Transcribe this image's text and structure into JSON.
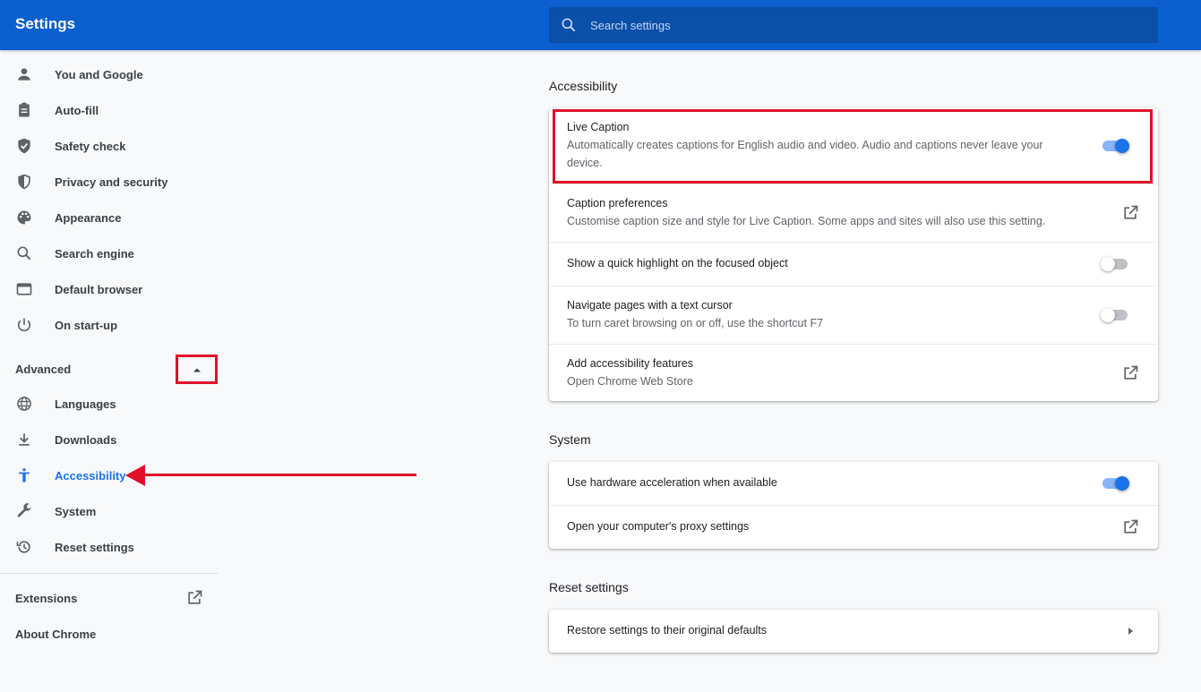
{
  "header": {
    "title": "Settings",
    "search_placeholder": "Search settings"
  },
  "sidebar": {
    "items": [
      {
        "label": "You and Google",
        "icon": "person-icon"
      },
      {
        "label": "Auto-fill",
        "icon": "clipboard-icon"
      },
      {
        "label": "Safety check",
        "icon": "shield-check-icon"
      },
      {
        "label": "Privacy and security",
        "icon": "shield-half-icon"
      },
      {
        "label": "Appearance",
        "icon": "palette-icon"
      },
      {
        "label": "Search engine",
        "icon": "search-icon"
      },
      {
        "label": "Default browser",
        "icon": "browser-window-icon"
      },
      {
        "label": "On start-up",
        "icon": "power-icon"
      }
    ],
    "advanced_label": "Advanced",
    "advanced_items": [
      {
        "label": "Languages",
        "icon": "globe-icon"
      },
      {
        "label": "Downloads",
        "icon": "download-icon"
      },
      {
        "label": "Accessibility",
        "icon": "accessibility-icon",
        "active": true
      },
      {
        "label": "System",
        "icon": "wrench-icon"
      },
      {
        "label": "Reset settings",
        "icon": "history-icon"
      }
    ],
    "extensions_label": "Extensions",
    "about_label": "About Chrome"
  },
  "accessibility": {
    "title": "Accessibility",
    "live_caption": {
      "title": "Live Caption",
      "desc_line1": "Automatically creates captions for English audio and video. Audio and captions never leave your",
      "desc_line2": "device.",
      "enabled": true
    },
    "caption_prefs": {
      "title": "Caption preferences",
      "desc": "Customise caption size and style for Live Caption. Some apps and sites will also use this setting."
    },
    "quick_highlight": {
      "title": "Show a quick highlight on the focused object",
      "enabled": false
    },
    "text_cursor": {
      "title": "Navigate pages with a text cursor",
      "desc": "To turn caret browsing on or off, use the shortcut F7",
      "enabled": false
    },
    "add_features": {
      "title": "Add accessibility features",
      "desc": "Open Chrome Web Store"
    }
  },
  "system": {
    "title": "System",
    "hw_accel": {
      "title": "Use hardware acceleration when available",
      "enabled": true
    },
    "proxy": {
      "title": "Open your computer's proxy settings"
    }
  },
  "reset": {
    "title": "Reset settings",
    "restore": {
      "title": "Restore settings to their original defaults"
    }
  },
  "colors": {
    "header_blue": "#0b5fcf",
    "accent": "#1a73e8",
    "annotation_red": "#e0102a"
  }
}
